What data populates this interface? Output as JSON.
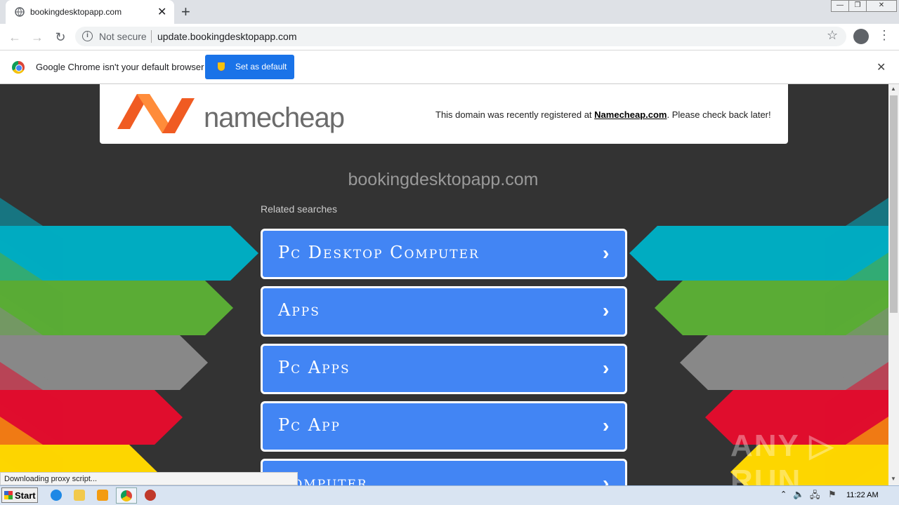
{
  "browser": {
    "tab_title": "bookingdesktopapp.com",
    "tab_close": "✕",
    "new_tab": "+",
    "window_buttons": {
      "minimize": "—",
      "restore": "❐",
      "close": "✕"
    },
    "nav": {
      "back": "←",
      "forward": "→",
      "reload": "↻"
    },
    "security_label": "Not secure",
    "url": "update.bookingdesktopapp.com",
    "bookmark": "☆",
    "menu": "⋮"
  },
  "infobar": {
    "message": "Google Chrome isn't your default browser",
    "button": "Set as default",
    "close": "✕"
  },
  "page": {
    "brand": "namecheap",
    "notice_prefix": "This domain was recently registered at ",
    "notice_link": "Namecheap.com",
    "notice_suffix": ". Please check back later!",
    "domain": "bookingdesktopapp.com",
    "related_heading": "Related searches",
    "links": [
      {
        "label": "Pc Desktop Computer",
        "chev": "›"
      },
      {
        "label": "Apps",
        "chev": "›"
      },
      {
        "label": "Pc Apps",
        "chev": "›"
      },
      {
        "label": "Pc App",
        "chev": "›"
      },
      {
        "label": "Computer",
        "chev": "›"
      }
    ],
    "band_colors": [
      "#00acc1",
      "#5aac35",
      "#888888",
      "#e00d2d",
      "#fdd600"
    ],
    "link_color": "#4285f4",
    "background": "#333333"
  },
  "status_text": "Downloading proxy script...",
  "watermark": "ANY ▷ RUN",
  "taskbar": {
    "start_label": "Start",
    "clock": "11:22 AM"
  }
}
